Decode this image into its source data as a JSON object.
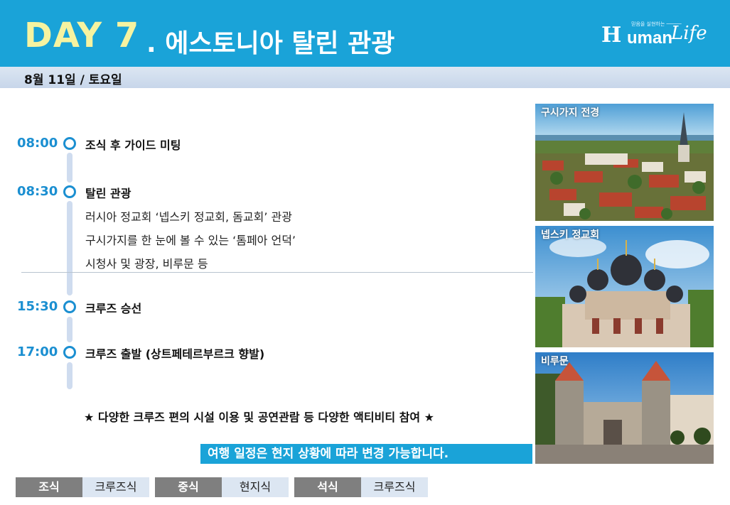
{
  "header": {
    "day": "DAY 7",
    "title": ". 에스토니아 탈린 관광",
    "brand": {
      "mark": "H",
      "word": "uman",
      "script": "Life",
      "tagline": "믿음을 실현하는 ─────"
    }
  },
  "date": "8월 11일 / 토요일",
  "schedule": [
    {
      "time": "08:00",
      "title": "조식 후 가이드 미팅",
      "details": []
    },
    {
      "time": "08:30",
      "title": "탈린 관광",
      "details": [
        "러시아 정교회 ‘넵스키 정교회, 돔교회’ 관광",
        "구시가지를 한 눈에 볼 수 있는 ‘톰페아 언덕’",
        "시청사 및 광장, 비루문 등"
      ]
    },
    {
      "time": "15:30",
      "title": "크루즈 승선",
      "details": []
    },
    {
      "time": "17:00",
      "title": "크루즈 출발 (상트페테르부르크 향발)",
      "details": []
    }
  ],
  "note": "★ 다양한 크루즈 편의 시설 이용 및 공연관람 등 다양한 액티비티 참여 ★",
  "notice": "여행 일정은 현지 상황에 따라 변경 가능합니다.",
  "meals": [
    {
      "label": "조식",
      "value": "크루즈식"
    },
    {
      "label": "중식",
      "value": "현지식"
    },
    {
      "label": "석식",
      "value": "크루즈식"
    }
  ],
  "photos": [
    {
      "caption": "구시가지 전경"
    },
    {
      "caption": "넵스키 정교회"
    },
    {
      "caption": "비루문"
    }
  ],
  "colors": {
    "header_blue": "#1aa3d8",
    "time_blue": "#1b8fd1",
    "day_yellow": "#f6f3a0",
    "meal_label_gray": "#7f7f7f",
    "meal_value_bg": "#dce6f2"
  }
}
